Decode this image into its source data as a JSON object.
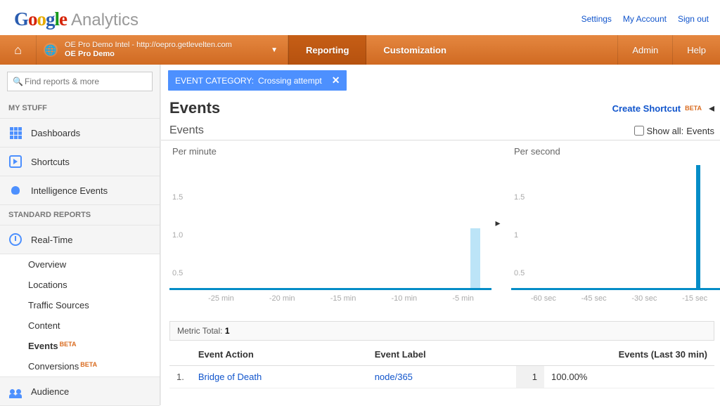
{
  "header": {
    "logo_analytics": "Analytics",
    "links": {
      "settings": "Settings",
      "account": "My Account",
      "signout": "Sign out"
    }
  },
  "nav": {
    "account_line1": "OE Pro Demo Intel - http://oepro.getlevelten.com",
    "account_line2": "OE Pro Demo",
    "reporting": "Reporting",
    "customization": "Customization",
    "admin": "Admin",
    "help": "Help"
  },
  "sidebar": {
    "search_placeholder": "Find reports & more",
    "my_stuff": "MY STUFF",
    "dashboards": "Dashboards",
    "shortcuts": "Shortcuts",
    "intelligence": "Intelligence Events",
    "standard": "STANDARD REPORTS",
    "realtime": "Real-Time",
    "sub": {
      "overview": "Overview",
      "locations": "Locations",
      "traffic": "Traffic Sources",
      "content": "Content",
      "events": "Events",
      "conversions": "Conversions"
    },
    "beta": "BETA",
    "audience": "Audience"
  },
  "filter": {
    "label": "EVENT CATEGORY:",
    "value": "Crossing attempt"
  },
  "page": {
    "title": "Events",
    "create_shortcut": "Create Shortcut",
    "beta": "BETA",
    "sub_label": "Events",
    "show_all_prefix": "Show all:",
    "show_all_value": "Events"
  },
  "charts": {
    "per_minute": "Per minute",
    "per_second": "Per second",
    "minute_y": {
      "a": "1.5",
      "b": "1.0",
      "c": "0.5"
    },
    "second_y": {
      "a": "1.5",
      "b": "1",
      "c": "0.5"
    },
    "minute_x": [
      "-25 min",
      "-20 min",
      "-15 min",
      "-10 min",
      "-5 min"
    ],
    "second_x": [
      "-60 sec",
      "-45 sec",
      "-30 sec",
      "-15 sec"
    ]
  },
  "metric": {
    "label": "Metric Total:",
    "value": "1"
  },
  "table": {
    "cols": {
      "action": "Event Action",
      "label": "Event Label",
      "events": "Events (Last 30 min)"
    },
    "row": {
      "idx": "1.",
      "action": "Bridge of Death",
      "label": "node/365",
      "count": "1",
      "pct": "100.00%"
    }
  },
  "chart_data": [
    {
      "type": "bar",
      "title": "Per minute",
      "xlabel": "",
      "ylabel": "",
      "ylim": [
        0,
        1.5
      ],
      "categories": [
        "-25 min",
        "-20 min",
        "-15 min",
        "-10 min",
        "-5 min",
        "-1 min"
      ],
      "values": [
        0,
        0,
        0,
        0,
        0,
        1
      ]
    },
    {
      "type": "bar",
      "title": "Per second",
      "xlabel": "",
      "ylabel": "",
      "ylim": [
        0,
        1.5
      ],
      "categories": [
        "-60 sec",
        "-45 sec",
        "-30 sec",
        "-15 sec"
      ],
      "values": [
        0,
        0,
        0,
        1
      ]
    }
  ]
}
